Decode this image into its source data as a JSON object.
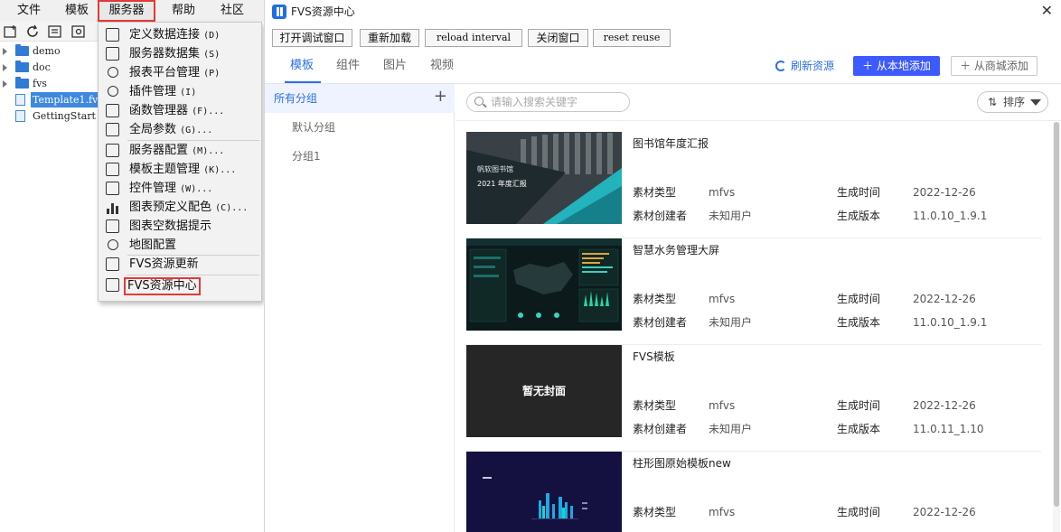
{
  "menubar": {
    "items": [
      "文件",
      "模板",
      "服务器",
      "帮助",
      "社区"
    ]
  },
  "tree": {
    "items": [
      {
        "label": "demo",
        "type": "folder"
      },
      {
        "label": "doc",
        "type": "folder"
      },
      {
        "label": "fvs",
        "type": "folder"
      },
      {
        "label": "Template1.fv",
        "type": "file",
        "selected": true
      },
      {
        "label": "GettingStart",
        "type": "file"
      }
    ]
  },
  "server_menu": {
    "items": [
      {
        "label": "定义数据连接",
        "hotkey": "(D)"
      },
      {
        "label": "服务器数据集",
        "hotkey": "(S)"
      },
      {
        "label": "报表平台管理",
        "hotkey": "(P)"
      },
      {
        "label": "插件管理",
        "hotkey": "(I)"
      },
      {
        "label": "函数管理器",
        "hotkey": "(F)..."
      },
      {
        "label": "全局参数",
        "hotkey": "(G)..."
      },
      {
        "label": "服务器配置",
        "hotkey": "(M)..."
      },
      {
        "label": "模板主题管理",
        "hotkey": "(K)..."
      },
      {
        "label": "控件管理",
        "hotkey": "(W)..."
      },
      {
        "label": "图表预定义配色",
        "hotkey": "(C)..."
      },
      {
        "label": "图表空数据提示",
        "hotkey": ""
      },
      {
        "label": "地图配置",
        "hotkey": ""
      },
      {
        "label": "FVS资源更新",
        "hotkey": ""
      },
      {
        "label": "FVS资源中心",
        "hotkey": ""
      }
    ]
  },
  "window": {
    "title": "FVS资源中心",
    "close": "✕",
    "commands": [
      "打开调试窗口",
      "重新加载",
      "reload interval",
      "关闭窗口",
      "reset reuse"
    ]
  },
  "tabs": [
    "模板",
    "组件",
    "图片",
    "视频"
  ],
  "actions": {
    "refresh": "刷新资源",
    "add_local": "＋ 从本地添加",
    "add_market": "＋ 从商城添加"
  },
  "groups": {
    "all": "所有分组",
    "plus": "+",
    "items": [
      "默认分组",
      "分组1"
    ]
  },
  "search": {
    "placeholder": "请输入搜索关键字"
  },
  "sort": {
    "label": "排序",
    "icon": "⇅"
  },
  "meta_labels": {
    "type": "素材类型",
    "creator": "素材创建者",
    "time": "生成时间",
    "version": "生成版本"
  },
  "cards": [
    {
      "title": "图书馆年度汇报",
      "type": "mfvs",
      "creator": "未知用户",
      "time": "2022-12-26",
      "version": "11.0.10_1.9.1",
      "thumb_text_1": "帆软图书馆",
      "thumb_text_2": "2021 年度汇报"
    },
    {
      "title": "智慧水务管理大屏",
      "type": "mfvs",
      "creator": "未知用户",
      "time": "2022-12-26",
      "version": "11.0.10_1.9.1"
    },
    {
      "title": "FVS模板",
      "type": "mfvs",
      "creator": "未知用户",
      "time": "2022-12-26",
      "version": "11.0.11_1.10",
      "thumb_text_1": "暂无封面"
    },
    {
      "title": "柱形图原始模板new",
      "type": "mfvs",
      "time": "2022-12-26"
    }
  ],
  "colors": {
    "accent": "#2b6fe6",
    "primary_button": "#3d5afe",
    "highlight_border": "#e53935"
  }
}
